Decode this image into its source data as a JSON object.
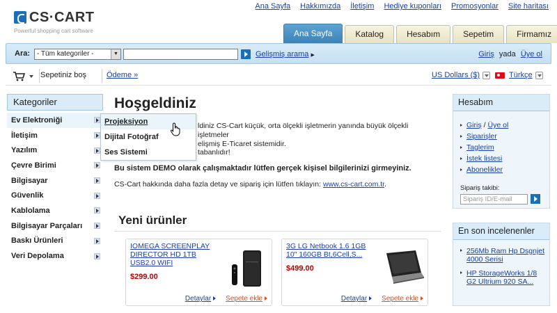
{
  "logo": {
    "text": "CS·CART",
    "tagline": "Powerful shopping cart software"
  },
  "top_links": [
    "Ana Sayfa",
    "Hakkımızda",
    "İletişim",
    "Hediye kuponları",
    "Promosyonlar",
    "Site haritası"
  ],
  "tabs": [
    {
      "label": "Ana Sayfa",
      "active": true
    },
    {
      "label": "Katalog"
    },
    {
      "label": "Hesabım"
    },
    {
      "label": "Sepetim"
    },
    {
      "label": "Firmamız"
    }
  ],
  "search": {
    "label": "Ara:",
    "category_selected": "- Tüm kategoriler -",
    "query": "",
    "advanced": "Gelişmiş arama"
  },
  "auth": {
    "login": "Giriş",
    "or": "yada",
    "register": "Üye ol"
  },
  "cart": {
    "status": "Sepetiniz boş",
    "checkout": "Ödeme »"
  },
  "currency": "US Dollars ($)",
  "language": "Türkçe",
  "categories": {
    "title": "Kategoriler",
    "items": [
      "Ev Elektroniği",
      "İletişim",
      "Yazılım",
      "Çevre Birimi",
      "Bilgisayar",
      "Güvenlik",
      "Kablolama",
      "Bilgisayar Parçaları",
      "Baskı Ürünleri",
      "Veri Depolama"
    ]
  },
  "flyout": [
    "Projeksiyon",
    "Dijital Fotoğraf",
    "Ses Sistemi"
  ],
  "main": {
    "title": "Hoşgeldiniz",
    "intro_line1": "ldiniz CS-Cart küçük, orta ölçekli işletmerin yanında büyük ölçekli işletmeler",
    "intro_line2": "elişmiş E-Ticaret sistemidir.",
    "intro3": "tabanlıdır!",
    "demo_warning": "Bu sistem DEMO olarak çalışmaktadır lütfen gerçek kişisel bilgilerinizi girmeyiniz.",
    "info_prefix": "CS-Cart hakkında daha fazla detay ve sipariş için lütfen tıklayın: ",
    "info_link": "www.cs-cart.com.tr",
    "info_suffix": "."
  },
  "new_products": {
    "title": "Yeni ürünler",
    "details_label": "Detaylar",
    "add_label": "Sepete ekle",
    "items": [
      {
        "name": "IOMEGA SCREENPLAY DIRECTOR HD 1TB USB2.0 WIFI",
        "price": "$299.00"
      },
      {
        "name": "3G LG Netbook 1.6 1GB 10\" 160GB Bt,6Cell,S...",
        "price": "$499.00"
      }
    ]
  },
  "account": {
    "title": "Hesabım",
    "links": [
      "Giriş",
      "Üye ol",
      "Siparişler",
      "Taglerim",
      "İstek listesi",
      "Abonelikler"
    ],
    "tracking_label": "Sipariş takibi:",
    "tracking_placeholder": "Sipariş ID/E-mail"
  },
  "recent": {
    "title": "En son incelenenler",
    "items": [
      "256Mb Ram Hp Dsgnjet 4000 Serisi",
      "HP StorageWorks 1/8 G2 Ultrium 920 SA..."
    ]
  }
}
